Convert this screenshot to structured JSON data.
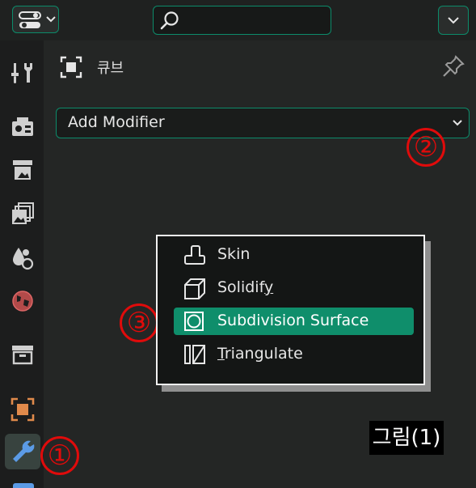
{
  "colors": {
    "accent": "#0c8b6a",
    "selected": "#0f8e6b",
    "callout": "#e00b0b"
  },
  "topbar": {
    "editor_type_icon": "editor-type-icon",
    "search": {
      "icon": "search-icon",
      "value": ""
    },
    "options_icon": "chevron-down-icon"
  },
  "tabs": [
    {
      "name": "tool",
      "icon": "tool-icon",
      "active": false
    },
    {
      "name": "render",
      "icon": "render-icon",
      "active": false
    },
    {
      "name": "output",
      "icon": "output-icon",
      "active": false
    },
    {
      "name": "view-layer",
      "icon": "view-layer-icon",
      "active": false
    },
    {
      "name": "scene",
      "icon": "scene-icon",
      "active": false
    },
    {
      "name": "world",
      "icon": "world-icon",
      "active": false
    },
    {
      "name": "collection",
      "icon": "collection-icon",
      "active": false
    },
    {
      "name": "object",
      "icon": "object-icon",
      "active": false
    },
    {
      "name": "modifier",
      "icon": "wrench-icon",
      "active": true
    }
  ],
  "header": {
    "object_name": "큐브",
    "pin_icon": "pin-icon"
  },
  "add_modifier": {
    "label": "Add Modifier"
  },
  "callouts": [
    "①",
    "②",
    "③"
  ],
  "menu": {
    "items": [
      {
        "pre": "Skin",
        "u": "",
        "post": "",
        "icon": "skin-icon",
        "selected": false
      },
      {
        "pre": "Solidif",
        "u": "y",
        "post": "",
        "icon": "solidify-icon",
        "selected": false
      },
      {
        "pre": "Subdivision Surface",
        "u": "",
        "post": "",
        "icon": "subdivision-surface-icon",
        "selected": true
      },
      {
        "pre": "",
        "u": "T",
        "post": "riangulate",
        "icon": "triangulate-icon",
        "selected": false
      }
    ]
  },
  "caption": "그림(1)"
}
